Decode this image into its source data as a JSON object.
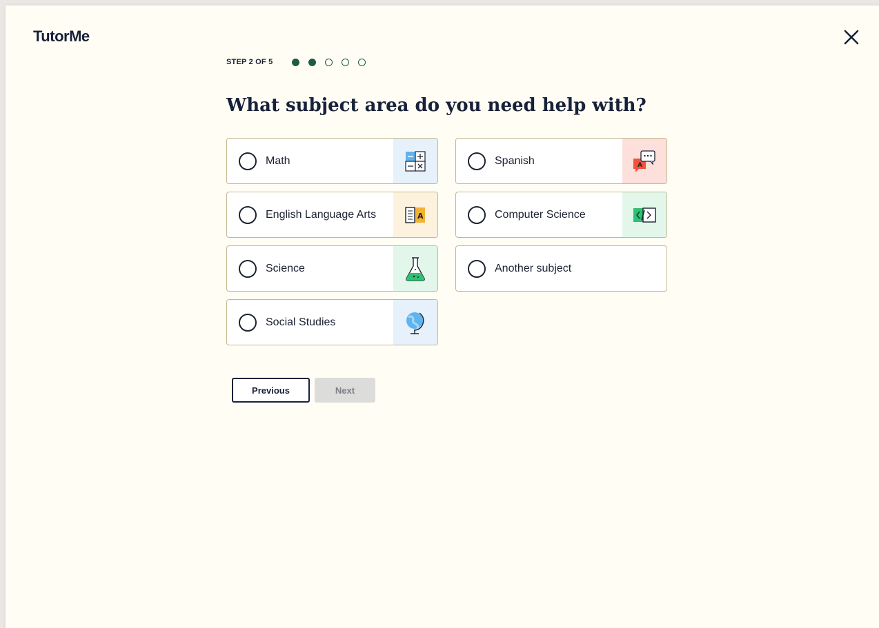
{
  "brand": {
    "logo_text": "TutorMe"
  },
  "header": {
    "close_icon": "close-icon"
  },
  "stepper": {
    "label": "STEP 2 OF 5",
    "current": 2,
    "total": 5
  },
  "question": {
    "title": "What subject area do you need help with?"
  },
  "options": [
    {
      "label": "Math",
      "icon": "calculator-icon",
      "tile_color": "#e6f1fb"
    },
    {
      "label": "Spanish",
      "icon": "speech-bubbles-icon",
      "tile_color": "#fde0dc"
    },
    {
      "label": "English Language Arts",
      "icon": "books-icon",
      "tile_color": "#fdf2dd"
    },
    {
      "label": "Computer Science",
      "icon": "code-icon",
      "tile_color": "#e2f7ea"
    },
    {
      "label": "Science",
      "icon": "flask-icon",
      "tile_color": "#e2f7ea"
    },
    {
      "label": "Another subject",
      "icon": "",
      "tile_color": ""
    },
    {
      "label": "Social Studies",
      "icon": "globe-icon",
      "tile_color": "#e6f1fb"
    }
  ],
  "buttons": {
    "previous_label": "Previous",
    "next_label": "Next",
    "next_disabled": true
  },
  "colors": {
    "accent": "#1e5c43",
    "background": "#fffdf4",
    "card_border": "#c3b892",
    "text": "#1b2232"
  }
}
